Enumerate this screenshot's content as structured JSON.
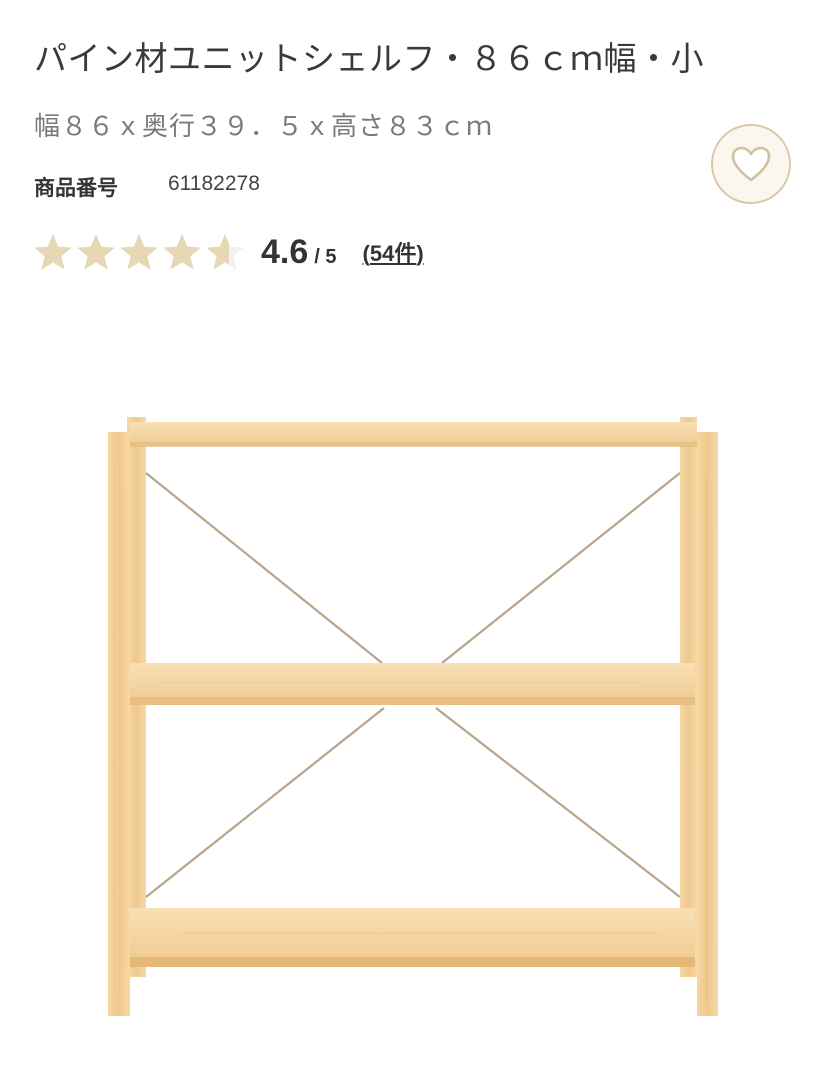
{
  "product": {
    "title": "パイン材ユニットシェルフ・８６ｃｍ幅・小",
    "dimensions": "幅８６ｘ奥行３９．５ｘ高さ８３ｃｍ",
    "number_label": "商品番号",
    "number_value": "61182278"
  },
  "rating": {
    "score": "4.6",
    "out_of": "/ 5",
    "count_open": "(",
    "count": "54件",
    "count_close": ")",
    "stars_value": 4.6,
    "max_stars": 5
  },
  "favorite": {
    "icon": "heart-icon"
  },
  "colors": {
    "star": "#e6d8b4",
    "heart_border": "#d8c9a6",
    "wood": "#f3cf97"
  },
  "image": {
    "subject": "shelf-image"
  }
}
